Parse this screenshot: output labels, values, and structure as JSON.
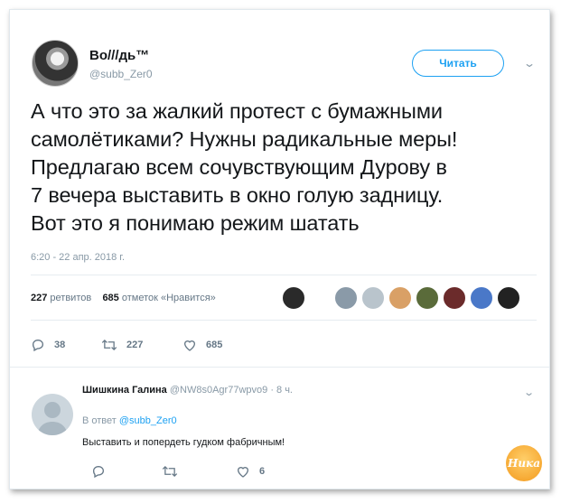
{
  "author": {
    "name": "Во///дь™",
    "handle": "@subb_Zer0"
  },
  "follow_button": {
    "label": "Читать"
  },
  "tweet": {
    "lines": [
      "А что это за жалкий протест с бумажными",
      "самолётиками? Нужны радикальные меры!",
      "Предлагаю всем сочувствующим Дурову в",
      "7 вечера выставить в окно голую задницу.",
      "Вот это я понимаю режим шатать"
    ],
    "timestamp": "6:20 - 22 апр. 2018 г."
  },
  "stats": {
    "retweets_count": "227",
    "retweets_label": "ретвитов",
    "likes_count": "685",
    "likes_label": "отметок «Нравится»"
  },
  "actions": {
    "reply_count": "38",
    "retweet_count": "227",
    "like_count": "685"
  },
  "reply": {
    "name": "Шишкина Галина",
    "handle": "@NW8s0Agr77wpvo9",
    "time": "· 8 ч.",
    "in_reply_prefix": "В ответ",
    "in_reply_handle": "@subb_Zer0",
    "text": "Выставить и попердеть гудком фабричным!",
    "like_count": "6"
  },
  "watermark": "Ника",
  "colors": {
    "accent": "#1da1f2",
    "muted": "#8899a6",
    "text": "#14171a"
  }
}
